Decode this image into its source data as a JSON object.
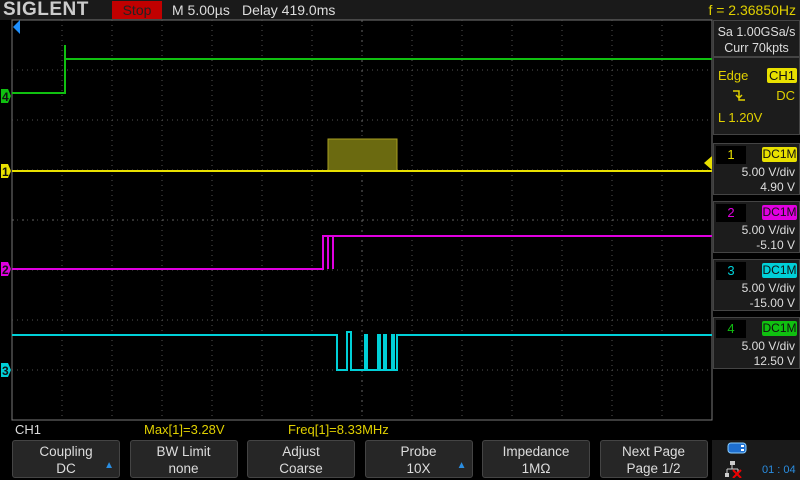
{
  "header": {
    "logo": "SIGLENT",
    "run_state": "Stop",
    "timebase": "M 5.00µs",
    "delay": "Delay 419.0ms",
    "frequency": "f = 2.36850Hz"
  },
  "acquisition": {
    "sample_rate": "Sa 1.00GSa/s",
    "memory": "Curr 70kpts"
  },
  "trigger": {
    "type": "Edge",
    "source": "CH1",
    "slope_icon": "falling-edge-icon",
    "coupling": "DC",
    "level": "L  1.20V"
  },
  "channels": [
    {
      "num": "1",
      "coupling": "DC1M",
      "scale": "5.00 V/div",
      "offset": "4.90 V",
      "color": "#e8e000"
    },
    {
      "num": "2",
      "coupling": "DC1M",
      "scale": "5.00 V/div",
      "offset": "-5.10 V",
      "color": "#e000e0"
    },
    {
      "num": "3",
      "coupling": "DC1M",
      "scale": "5.00 V/div",
      "offset": "-15.00 V",
      "color": "#00d0d8"
    },
    {
      "num": "4",
      "coupling": "DC1M",
      "scale": "5.00 V/div",
      "offset": "12.50 V",
      "color": "#10c010"
    }
  ],
  "measure": {
    "channel": "CH1",
    "max": "Max[1]=3.28V",
    "freq": "Freq[1]=8.33MHz"
  },
  "menu": [
    {
      "title": "Coupling",
      "value": "DC",
      "arrow": true
    },
    {
      "title": "BW Limit",
      "value": "none",
      "arrow": false
    },
    {
      "title": "Adjust",
      "value": "Coarse",
      "arrow": false
    },
    {
      "title": "Probe",
      "value": "10X",
      "arrow": true
    },
    {
      "title": "Impedance",
      "value": "1MΩ",
      "arrow": false
    },
    {
      "title": "Next Page",
      "value": "Page 1/2",
      "arrow": false
    }
  ],
  "status": {
    "time": "01 : 04",
    "usb_icon": "usb-icon",
    "network_icon": "network-disconnected-icon"
  }
}
